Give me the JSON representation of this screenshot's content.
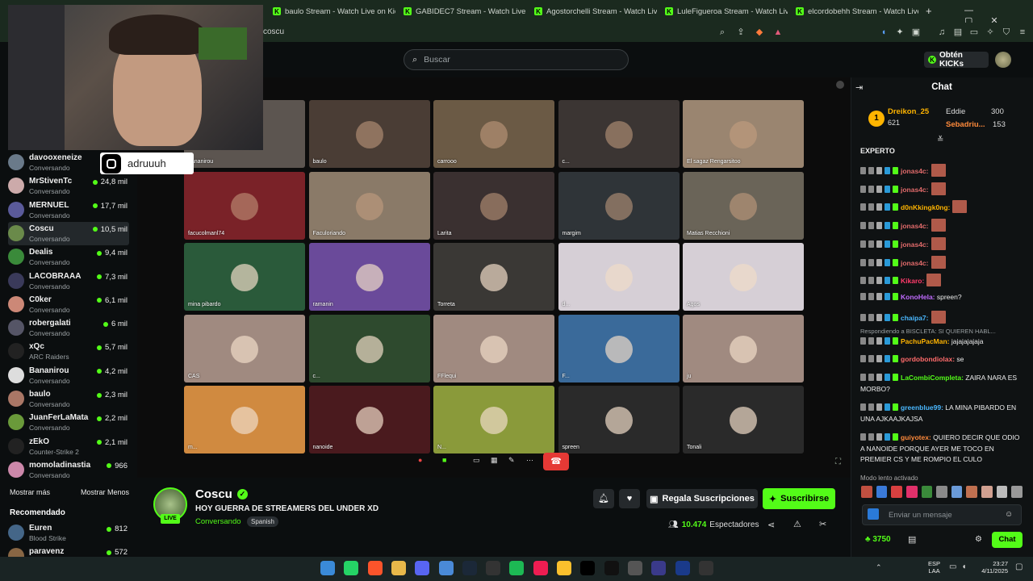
{
  "browser": {
    "tabs": [
      {
        "label": "baulo Stream - Watch Live on Kick"
      },
      {
        "label": "GABIDEC7 Stream - Watch Live on K"
      },
      {
        "label": "Agostorchelli Stream - Watch Live on"
      },
      {
        "label": "LuleFigueroa Stream - Watch Live on"
      },
      {
        "label": "elcordobehh Stream - Watch Live on"
      }
    ],
    "url": "coscu"
  },
  "header": {
    "search_placeholder": "Buscar",
    "get_kicks_label": "Obtén KICKs"
  },
  "overlay": {
    "instagram_handle": "adruuuh"
  },
  "sidebar": {
    "channels": [
      {
        "name": "davooxeneize",
        "category": "Conversando",
        "viewers": "",
        "color": "#6a7a8a"
      },
      {
        "name": "MrStivenTc",
        "category": "Conversando",
        "viewers": "24,8 mil",
        "color": "#caa"
      },
      {
        "name": "MERNUEL",
        "category": "Conversando",
        "viewers": "17,7 mil",
        "color": "#5a5a9a"
      },
      {
        "name": "Coscu",
        "category": "Conversando",
        "viewers": "10,5 mil",
        "color": "#6a8a4a"
      },
      {
        "name": "Dealis",
        "category": "Conversando",
        "viewers": "9,4 mil",
        "color": "#3a8a3a"
      },
      {
        "name": "LACOBRAAA",
        "category": "Conversando",
        "viewers": "7,3 mil",
        "color": "#3a3a5a"
      },
      {
        "name": "C0ker",
        "category": "Conversando",
        "viewers": "6,1 mil",
        "color": "#c87"
      },
      {
        "name": "robergalati",
        "category": "Conversando",
        "viewers": "6 mil",
        "color": "#556"
      },
      {
        "name": "xQc",
        "category": "ARC Raiders",
        "viewers": "5,7 mil",
        "color": "#222"
      },
      {
        "name": "Bananirou",
        "category": "Conversando",
        "viewers": "4,2 mil",
        "color": "#ddd"
      },
      {
        "name": "baulo",
        "category": "Conversando",
        "viewers": "2,3 mil",
        "color": "#a76"
      },
      {
        "name": "JuanFerLaMata",
        "category": "Conversando",
        "viewers": "2,2 mil",
        "color": "#6a9a3a"
      },
      {
        "name": "zEkO",
        "category": "Counter-Strike 2",
        "viewers": "2,1 mil",
        "color": "#222"
      },
      {
        "name": "momoladinastia",
        "category": "Conversando",
        "viewers": "966",
        "color": "#c8a"
      }
    ],
    "show_more": "Mostrar más",
    "show_less": "Mostrar Menos",
    "recommended_title": "Recomendado",
    "recommended": [
      {
        "name": "Euren",
        "category": "Blood Strike",
        "viewers": "812",
        "color": "#468"
      },
      {
        "name": "paravenz",
        "category": "",
        "viewers": "572",
        "color": "#864"
      }
    ]
  },
  "video": {
    "tiles": [
      {
        "label": "bananirou",
        "color": "#5c5550"
      },
      {
        "label": "baulo",
        "color": "#4a3d35"
      },
      {
        "label": "carrooo",
        "color": "#6b5a45"
      },
      {
        "label": "c...",
        "color": "#3b3533"
      },
      {
        "label": "El sagaz Rengarsitoo",
        "color": "#9a8570"
      },
      {
        "label": "facucolmanl74",
        "color": "#7a2228"
      },
      {
        "label": "Faculoriando",
        "color": "#8a7a68"
      },
      {
        "label": "Larita",
        "color": "#3a3030"
      },
      {
        "label": "margim",
        "color": "#2f3438"
      },
      {
        "label": "Matias Recchioni",
        "color": "#6a6458"
      },
      {
        "label": "mina pibardo",
        "color": "#2a5a3a"
      },
      {
        "label": "ramanin",
        "color": "#6a4a9a"
      },
      {
        "label": "Torreta",
        "color": "#3a3835"
      },
      {
        "label": "d...",
        "color": "#d6cfd6"
      },
      {
        "label": "Agos",
        "color": "#d6cfd6"
      },
      {
        "label": "CAS",
        "color": "#a08a80"
      },
      {
        "label": "c...",
        "color": "#2e4a2e"
      },
      {
        "label": "FFlequi",
        "color": "#a08a80"
      },
      {
        "label": "F...",
        "color": "#3a6a9a"
      },
      {
        "label": "ju",
        "color": "#a08a80"
      },
      {
        "label": "m...",
        "color": "#d08a40"
      },
      {
        "label": "nanoide",
        "color": "#4a1a1e"
      },
      {
        "label": "N...",
        "color": "#8a9a3a"
      },
      {
        "label": "spreen",
        "color": "#2a2a2a"
      },
      {
        "label": "Tonali",
        "color": "#2a2a2a"
      }
    ]
  },
  "stream": {
    "name": "Coscu",
    "live_badge": "LIVE",
    "title": "HOY GUERRA DE STREAMERS DEL UNDER XD",
    "category": "Conversando",
    "language": "Spanish",
    "gift_label": "Regala Suscripciones",
    "subscribe_label": "Suscribirse",
    "viewer_count": "10.474",
    "viewer_label": "Espectadores"
  },
  "chat": {
    "title": "Chat",
    "top": [
      {
        "rank": "1",
        "name": "Dreikon_25",
        "amount": "621"
      },
      {
        "name": "Eddie",
        "amount": "300"
      },
      {
        "name": "Sebadriu...",
        "amount": "153"
      }
    ],
    "section": "EXPERTO",
    "messages": [
      {
        "user": "jonas4c:",
        "text": "",
        "color": "#e26b6b"
      },
      {
        "user": "jonas4c:",
        "text": "",
        "color": "#e26b6b"
      },
      {
        "user": "d0nKkingk0ng:",
        "text": "",
        "color": "#ffb400"
      },
      {
        "user": "jonas4c:",
        "text": "",
        "color": "#e26b6b"
      },
      {
        "user": "jonas4c:",
        "text": "",
        "color": "#e26b6b"
      },
      {
        "user": "jonas4c:",
        "text": "",
        "color": "#e26b6b"
      },
      {
        "user": "Kikaro:",
        "text": "",
        "color": "#ff3b6b"
      },
      {
        "user": "KonoHela:",
        "text": " spreen?",
        "color": "#c06bff"
      },
      {
        "user": "chaipa7:",
        "text": "",
        "color": "#4ab8ff"
      }
    ],
    "reply_note": "Respondiendo a BISCLETA: SI QUIEREN HABL...",
    "messages2": [
      {
        "user": "PachuPacMan:",
        "text": " jajajajajaja",
        "color": "#ffb400"
      },
      {
        "user": "gordobondiolax:",
        "text": " se",
        "color": "#ff6b6b"
      },
      {
        "user": "LaCombiCompleta:",
        "text": " ZAIRA NARA ES MORBO?",
        "color": "#53fc18"
      },
      {
        "user": "greenblue99:",
        "text": " LA MINA PIBARDO EN UNA AJKAAJKAJSA",
        "color": "#4ab8ff"
      },
      {
        "user": "guiyotex:",
        "text": " QUIERO DECIR QUE ODIO A NANOIDE PORQUE AYER ME TOCO EN PREMIER CS Y ME ROMPIO EL CULO",
        "color": "#ff8a3b"
      }
    ],
    "slow_mode": "Modo lento activado",
    "input_placeholder": "Enviar un mensaje",
    "points": "3750",
    "send_label": "Chat"
  },
  "taskbar": {
    "lang": "ESP",
    "region": "LAA",
    "time": "23:27",
    "date": "4/11/2025"
  },
  "colors": {
    "accent": "#53fc18",
    "background": "#0b0e0f"
  }
}
